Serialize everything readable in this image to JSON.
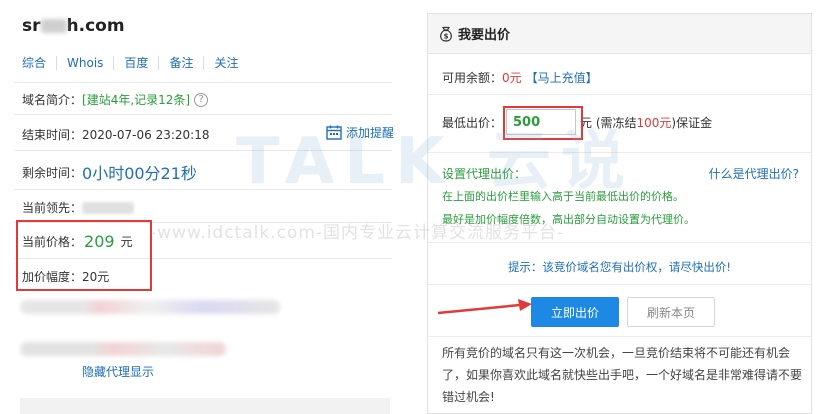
{
  "domain": {
    "prefix": "sr",
    "suffix": "h.com"
  },
  "tabs": [
    "综合",
    "Whois",
    "百度",
    "备注",
    "关注"
  ],
  "summary": {
    "label": "域名简介：",
    "value": "[建站4年,记录12条]",
    "help_icon": "?"
  },
  "end_time": {
    "label": "结束时间：",
    "value": "2020-07-06 23:20:18",
    "remind_label": "添加提醒"
  },
  "remaining": {
    "label": "剩余时间：",
    "value": "0小时00分21秒"
  },
  "leader": {
    "label": "当前领先："
  },
  "current_price": {
    "label": "当前价格：",
    "value": "209",
    "unit": "元"
  },
  "increment": {
    "label": "加价幅度：",
    "value": "20元"
  },
  "hide_proxy_label": "隐藏代理显示",
  "bid_panel": {
    "title": "我要出价",
    "balance_label": "可用余额：",
    "balance_value": "0元",
    "recharge_label": "【马上充值】",
    "min_bid_label": "最低出价：",
    "min_bid_value": "500",
    "deposit_prefix": "元 (需冻结",
    "deposit_amount": "100元",
    "deposit_suffix": ")保证金",
    "proxy_title": "设置代理出价：",
    "proxy_question": "什么是代理出价?",
    "proxy_desc_1": "在上面的出价栏里输入高于当前最低出价的价格。",
    "proxy_desc_2": "最好是加价幅度倍数，高出部分自动设置为代理价。",
    "tip": "提示：该竞价域名您有出价权，请尽快出价!",
    "bid_button": "立即出价",
    "refresh_button": "刷新本页",
    "notice": "所有竞价的域名只有这一次机会，一旦竞价结束将不可能还有机会了，如果你喜欢此域名就快些出手吧，一个好域名是非常难得请不要错过机会!"
  },
  "watermark": {
    "logo": "TALK 云说",
    "url": "-www.idctalk.com-国内专业云计算交流服务平台-"
  },
  "colors": {
    "link_blue": "#1e6fb8",
    "price_green": "#2a9d3c",
    "alert_red": "#e03a3a",
    "button_blue": "#1e88e5"
  }
}
